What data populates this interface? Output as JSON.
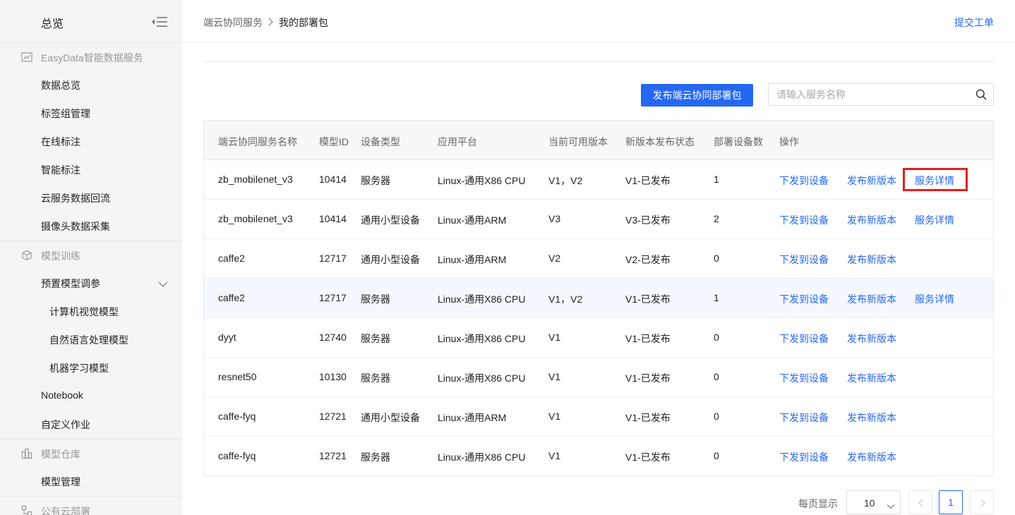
{
  "sidebar": {
    "title": "总览",
    "groups": [
      {
        "label": "EasyData智能数据服务",
        "icon": "chart-line-icon"
      },
      {
        "label": "模型训练",
        "icon": "cube-icon"
      },
      {
        "label": "模型仓库",
        "icon": "warehouse-icon"
      },
      {
        "label": "公有云部署",
        "icon": "cloud-deploy-icon"
      }
    ],
    "items": [
      {
        "label": "数据总览"
      },
      {
        "label": "标签组管理"
      },
      {
        "label": "在线标注"
      },
      {
        "label": "智能标注"
      },
      {
        "label": "云服务数据回流"
      },
      {
        "label": "摄像头数据采集"
      },
      {
        "label": "预置模型调参"
      },
      {
        "label": "计算机视觉模型"
      },
      {
        "label": "自然语言处理模型"
      },
      {
        "label": "机器学习模型"
      },
      {
        "label": "Notebook"
      },
      {
        "label": "自定义作业"
      },
      {
        "label": "模型管理"
      }
    ]
  },
  "header": {
    "breadcrumb_parent": "端云协同服务",
    "breadcrumb_current": "我的部署包",
    "submit_ticket": "提交工单"
  },
  "toolbar": {
    "publish_label": "发布端云协同部署包",
    "search_placeholder": "请输入服务名称"
  },
  "table": {
    "columns": [
      "端云协同服务名称",
      "模型ID",
      "设备类型",
      "应用平台",
      "当前可用版本",
      "新版本发布状态",
      "部署设备数",
      "操作"
    ],
    "actions": {
      "deploy": "下发到设备",
      "publish": "发布新版本",
      "detail": "服务详情"
    },
    "rows": [
      {
        "name": "zb_mobilenet_v3",
        "model_id": "10414",
        "device_type": "服务器",
        "platform": "Linux-通用X86 CPU",
        "versions": "V1，V2",
        "status": "V1-已发布",
        "devices": "1",
        "has_detail": true,
        "highlight": false,
        "marked": true
      },
      {
        "name": "zb_mobilenet_v3",
        "model_id": "10414",
        "device_type": "通用小型设备",
        "platform": "Linux-通用ARM",
        "versions": "V3",
        "status": "V3-已发布",
        "devices": "2",
        "has_detail": true,
        "highlight": false,
        "marked": false
      },
      {
        "name": "caffe2",
        "model_id": "12717",
        "device_type": "通用小型设备",
        "platform": "Linux-通用ARM",
        "versions": "V2",
        "status": "V2-已发布",
        "devices": "0",
        "has_detail": false,
        "highlight": false,
        "marked": false
      },
      {
        "name": "caffe2",
        "model_id": "12717",
        "device_type": "服务器",
        "platform": "Linux-通用X86 CPU",
        "versions": "V1，V2",
        "status": "V1-已发布",
        "devices": "1",
        "has_detail": true,
        "highlight": true,
        "marked": false
      },
      {
        "name": "dyyt",
        "model_id": "12740",
        "device_type": "服务器",
        "platform": "Linux-通用X86 CPU",
        "versions": "V1",
        "status": "V1-已发布",
        "devices": "0",
        "has_detail": false,
        "highlight": false,
        "marked": false
      },
      {
        "name": "resnet50",
        "model_id": "10130",
        "device_type": "服务器",
        "platform": "Linux-通用X86 CPU",
        "versions": "V1",
        "status": "V1-已发布",
        "devices": "0",
        "has_detail": false,
        "highlight": false,
        "marked": false
      },
      {
        "name": "caffe-fyq",
        "model_id": "12721",
        "device_type": "通用小型设备",
        "platform": "Linux-通用ARM",
        "versions": "V1",
        "status": "V1-已发布",
        "devices": "0",
        "has_detail": false,
        "highlight": false,
        "marked": false
      },
      {
        "name": "caffe-fyq",
        "model_id": "12721",
        "device_type": "服务器",
        "platform": "Linux-通用X86 CPU",
        "versions": "V1",
        "status": "V1-已发布",
        "devices": "0",
        "has_detail": false,
        "highlight": false,
        "marked": false
      }
    ]
  },
  "pagination": {
    "page_size_label": "每页显示",
    "page_size": "10",
    "current_page": "1"
  },
  "colors": {
    "accent": "#2468f2",
    "highlight_box": "#e02020",
    "sidebar_bg": "#f4f5f7"
  }
}
